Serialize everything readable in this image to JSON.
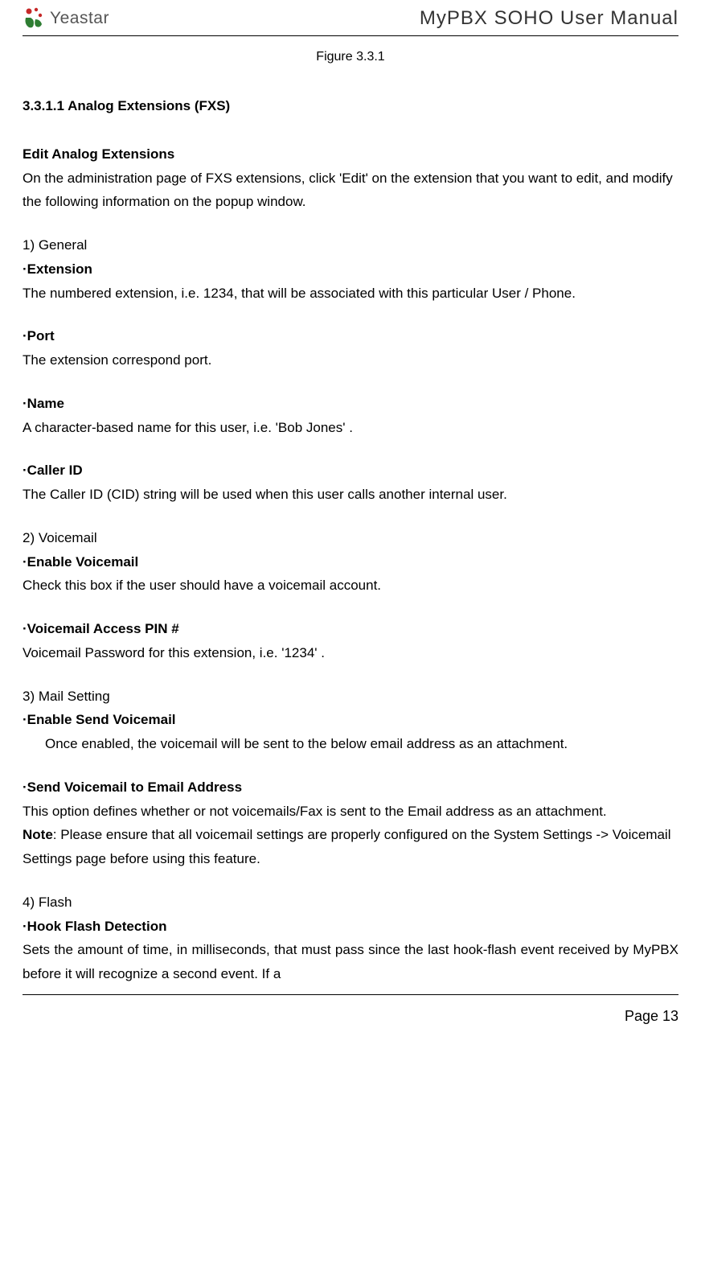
{
  "header": {
    "logo_text": "Yeastar",
    "title": "MyPBX SOHO User Manual"
  },
  "figure_caption": "Figure 3.3.1",
  "section_title": "3.3.1.1 Analog Extensions (FXS)",
  "edit_heading": "Edit Analog Extensions",
  "edit_desc": "On the administration page of FXS extensions, click 'Edit' on the extension that you want to edit, and modify the following information on the popup window.",
  "general": {
    "heading": "1) General",
    "extension_label": "·Extension",
    "extension_desc": "The numbered extension, i.e. 1234, that will be associated with this particular User / Phone.",
    "port_label": "·Port",
    "port_desc": "The extension correspond port.",
    "name_label": "·Name",
    "name_desc": "A character-based name for this user, i.e. 'Bob Jones' .",
    "callerid_label": "·Caller ID",
    "callerid_desc": "The Caller ID (CID) string will be used when this user calls another internal user."
  },
  "voicemail": {
    "heading": "2) Voicemail",
    "enable_label": "·Enable Voicemail",
    "enable_desc": "Check this box if the user should have a voicemail account.",
    "pin_label": "·Voicemail Access PIN #",
    "pin_desc": "Voicemail Password for this extension, i.e. '1234' ."
  },
  "mail": {
    "heading": "3) Mail Setting",
    "enable_send_label": "·Enable Send Voicemail",
    "enable_send_desc": "Once enabled, the voicemail will be sent to the below email address as an attachment.",
    "send_email_label": "·Send Voicemail to Email Address",
    "send_email_desc": "This option defines whether or not voicemails/Fax is sent to the Email address as an attachment.",
    "note_label": "Note",
    "note_desc": ": Please ensure that all voicemail settings are properly configured on the System Settings -> Voicemail Settings page before using this feature."
  },
  "flash": {
    "heading": "4) Flash",
    "hook_label": "·Hook Flash Detection",
    "hook_desc": "Sets the amount of time, in milliseconds, that must pass since the last hook-flash event received by MyPBX before it will recognize a second event. If a"
  },
  "footer": {
    "page_label": "Page 13"
  }
}
